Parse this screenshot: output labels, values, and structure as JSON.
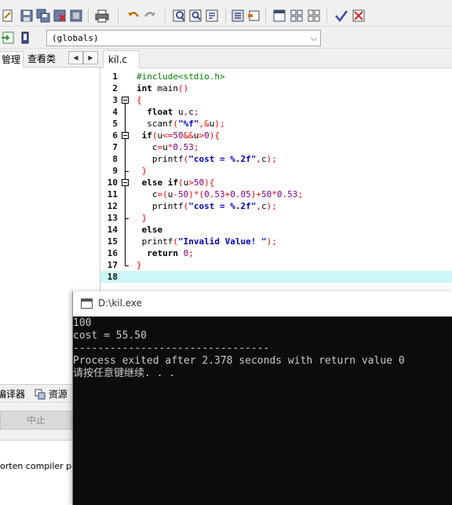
{
  "toolbar": {
    "icons": [
      "new-icon",
      "save-icon",
      "save-all-icon",
      "close-icon",
      "print-icon",
      "undo-icon",
      "redo-icon",
      "find-icon",
      "replace-icon",
      "goto-icon",
      "bookmark-icon",
      "indent-icon",
      "window-icon",
      "grid-icon",
      "check-icon",
      "compile-icon"
    ]
  },
  "scope": {
    "value": "(globals)"
  },
  "left_panel": {
    "tabs": [
      "管理",
      "查看类"
    ],
    "nav_prev": "◀",
    "nav_next": "▶"
  },
  "bottom_panel": {
    "tab_compiler": "编译器",
    "tab_resources": "资源",
    "abort_label": "中止",
    "log_text": "orten compiler pa"
  },
  "editor": {
    "file_tab": "kil.c",
    "lines": [
      {
        "n": "1",
        "parts": [
          [
            "pp",
            "#include<stdio.h>"
          ]
        ]
      },
      {
        "n": "2",
        "parts": [
          [
            "kw",
            "int"
          ],
          [
            "fn",
            " main"
          ],
          [
            "sym",
            "()"
          ]
        ]
      },
      {
        "n": "3",
        "parts": [
          [
            "sym",
            "{"
          ]
        ]
      },
      {
        "n": "4",
        "parts": [
          [
            "fn",
            "  "
          ],
          [
            "kw",
            "float"
          ],
          [
            "fn",
            " u"
          ],
          [
            "sym",
            ","
          ],
          [
            "fn",
            "c"
          ],
          [
            "sym",
            ";"
          ]
        ]
      },
      {
        "n": "5",
        "parts": [
          [
            "fn",
            "  scanf"
          ],
          [
            "sym",
            "("
          ],
          [
            "str",
            "\"%f\""
          ],
          [
            "sym",
            ",&"
          ],
          [
            "fn",
            "u"
          ],
          [
            "sym",
            ");"
          ]
        ]
      },
      {
        "n": "6",
        "parts": [
          [
            "fn",
            " "
          ],
          [
            "kw",
            "if"
          ],
          [
            "sym",
            "("
          ],
          [
            "fn",
            "u"
          ],
          [
            "sym",
            "<="
          ],
          [
            "num",
            "50"
          ],
          [
            "sym",
            "&&"
          ],
          [
            "fn",
            "u"
          ],
          [
            "sym",
            ">"
          ],
          [
            "num",
            "0"
          ],
          [
            "sym",
            "){"
          ]
        ]
      },
      {
        "n": "7",
        "parts": [
          [
            "fn",
            "   c"
          ],
          [
            "sym",
            "="
          ],
          [
            "fn",
            "u"
          ],
          [
            "sym",
            "*"
          ],
          [
            "num",
            "0.53"
          ],
          [
            "sym",
            ";"
          ]
        ]
      },
      {
        "n": "8",
        "parts": [
          [
            "fn",
            "   printf"
          ],
          [
            "sym",
            "("
          ],
          [
            "str",
            "\"cost = %.2f\""
          ],
          [
            "sym",
            ","
          ],
          [
            "fn",
            "c"
          ],
          [
            "sym",
            ");"
          ]
        ]
      },
      {
        "n": "9",
        "parts": [
          [
            "fn",
            " "
          ],
          [
            "sym",
            "}"
          ]
        ]
      },
      {
        "n": "10",
        "parts": [
          [
            "fn",
            " "
          ],
          [
            "kw",
            "else if"
          ],
          [
            "sym",
            "("
          ],
          [
            "fn",
            "u"
          ],
          [
            "sym",
            ">"
          ],
          [
            "num",
            "50"
          ],
          [
            "sym",
            "){"
          ]
        ]
      },
      {
        "n": "11",
        "parts": [
          [
            "fn",
            "   c"
          ],
          [
            "sym",
            "=("
          ],
          [
            "fn",
            "u"
          ],
          [
            "sym",
            "-"
          ],
          [
            "num",
            "50"
          ],
          [
            "sym",
            ")*("
          ],
          [
            "num",
            "0.53"
          ],
          [
            "sym",
            "+"
          ],
          [
            "num",
            "0.05"
          ],
          [
            "sym",
            ")+"
          ],
          [
            "num",
            "50"
          ],
          [
            "sym",
            "*"
          ],
          [
            "num",
            "0.53"
          ],
          [
            "sym",
            ";"
          ]
        ]
      },
      {
        "n": "12",
        "parts": [
          [
            "fn",
            "   printf"
          ],
          [
            "sym",
            "("
          ],
          [
            "str",
            "\"cost = %.2f\""
          ],
          [
            "sym",
            ","
          ],
          [
            "fn",
            "c"
          ],
          [
            "sym",
            ");"
          ]
        ]
      },
      {
        "n": "13",
        "parts": [
          [
            "fn",
            " "
          ],
          [
            "sym",
            "}"
          ]
        ]
      },
      {
        "n": "14",
        "parts": [
          [
            "fn",
            " "
          ],
          [
            "kw",
            "else"
          ]
        ]
      },
      {
        "n": "15",
        "parts": [
          [
            "fn",
            " printf"
          ],
          [
            "sym",
            "("
          ],
          [
            "str",
            "\"Invalid Value! \""
          ],
          [
            "sym",
            ");"
          ]
        ]
      },
      {
        "n": "16",
        "parts": [
          [
            "fn",
            "  "
          ],
          [
            "kw",
            "return"
          ],
          [
            "fn",
            " "
          ],
          [
            "num",
            "0"
          ],
          [
            "sym",
            ";"
          ]
        ]
      },
      {
        "n": "17",
        "parts": [
          [
            "sym",
            "}"
          ]
        ]
      },
      {
        "n": "18",
        "parts": []
      }
    ]
  },
  "console": {
    "title": "D:\\kil.exe",
    "lines": [
      "100",
      "cost = 55.50",
      "--------------------------------",
      "Process exited after 2.378 seconds with return value 0",
      "请按任意键继续. . ."
    ]
  }
}
